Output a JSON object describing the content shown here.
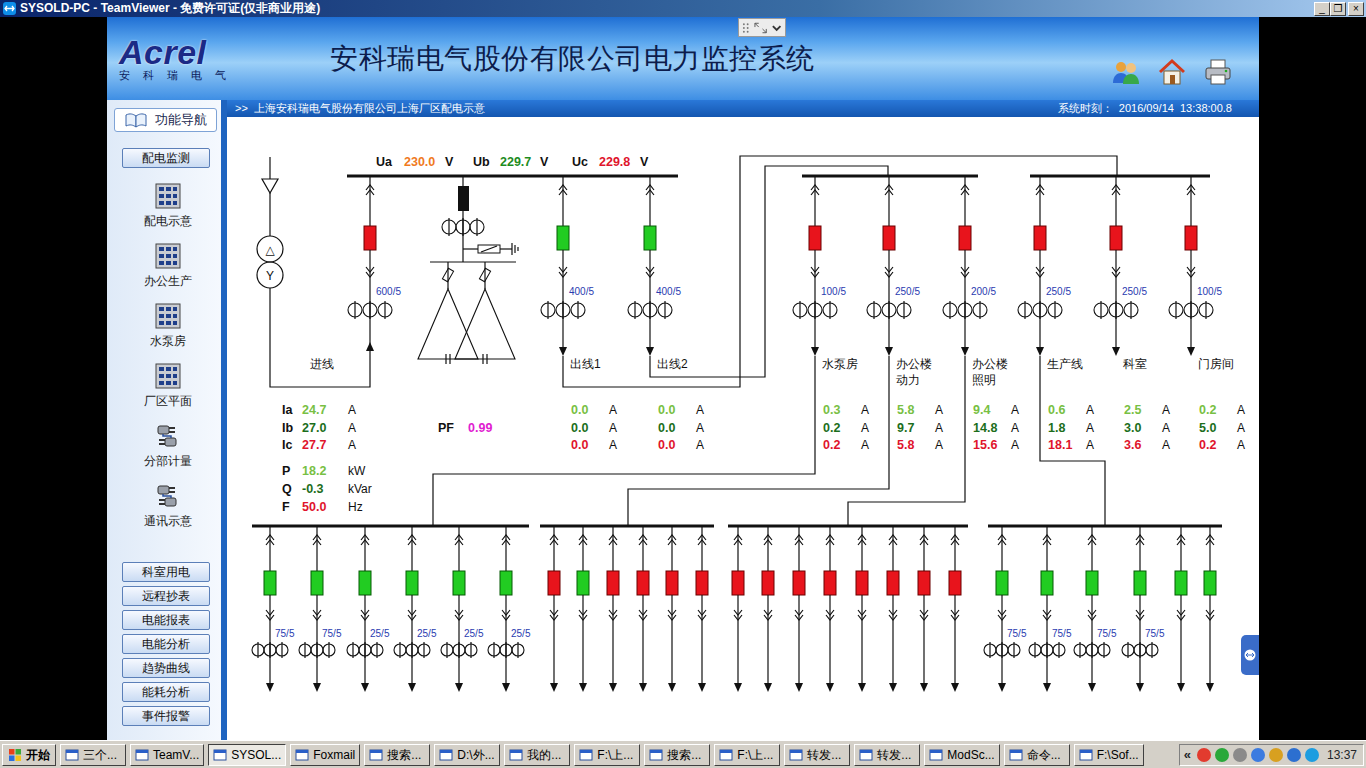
{
  "window": {
    "title": "SYSOLD-PC - TeamViewer - 免费许可证(仅非商业用途)",
    "controls": [
      "_",
      "❐",
      "×"
    ]
  },
  "header": {
    "logo": "Acrel",
    "logo_sub": "安 科 瑞 电 气",
    "title": "安科瑞电气股份有限公司电力监控系统"
  },
  "sidebar": {
    "nav": "功能导航",
    "section": "配电监测",
    "icon_items": [
      {
        "label": "配电示意",
        "kind": "panel"
      },
      {
        "label": "办公生产",
        "kind": "panel"
      },
      {
        "label": "水泵房",
        "kind": "panel"
      },
      {
        "label": "厂区平面",
        "kind": "panel"
      },
      {
        "label": "分部计量",
        "kind": "meter"
      },
      {
        "label": "通讯示意",
        "kind": "meter"
      }
    ],
    "buttons": [
      "科室用电",
      "远程抄表",
      "电能报表",
      "电能分析",
      "趋势曲线",
      "能耗分析",
      "事件报警"
    ]
  },
  "breadcrumb": {
    "marker": ">>",
    "path": "上海安科瑞电气股份有限公司上海厂区配电示意",
    "clock_label": "系统时刻：",
    "clock": "2016/09/14  13:38:00.8"
  },
  "diagram": {
    "voltages": [
      {
        "label": "Ua",
        "value": "230.0",
        "unit": "V",
        "color": "#f07a1e"
      },
      {
        "label": "Ub",
        "value": "229.7",
        "unit": "V",
        "color": "#1e8c1e"
      },
      {
        "label": "Uc",
        "value": "229.8",
        "unit": "V",
        "color": "#e0142c"
      }
    ],
    "winding": [
      "△",
      "Y"
    ],
    "incoming": {
      "label": "进线",
      "ct": "600/5",
      "closed": true,
      "currents": [
        {
          "label": "Ia",
          "value": "24.7",
          "unit": "A",
          "color": "#78c043"
        },
        {
          "label": "Ib",
          "value": "27.0",
          "unit": "A",
          "color": "#1c6e1c"
        },
        {
          "label": "Ic",
          "value": "27.7",
          "unit": "A",
          "color": "#e0142c"
        }
      ],
      "power": [
        {
          "label": "P",
          "value": "18.2",
          "unit": "kW",
          "color": "#78c043"
        },
        {
          "label": "Q",
          "value": "-0.3",
          "unit": "kVar",
          "color": "#1c6e1c"
        },
        {
          "label": "F",
          "value": "50.0",
          "unit": "Hz",
          "color": "#e0142c"
        }
      ],
      "pf": {
        "label": "PF",
        "value": "0.99"
      }
    },
    "current_unit": "A",
    "phase_colors": [
      "#78c043",
      "#1c6e1c",
      "#e0142c"
    ],
    "feeders": [
      {
        "label_lines": [
          "出线1"
        ],
        "ct": "400/5",
        "closed": false,
        "currents": [
          "0.0",
          "0.0",
          "0.0"
        ]
      },
      {
        "label_lines": [
          "出线2"
        ],
        "ct": "400/5",
        "closed": false,
        "currents": [
          "0.0",
          "0.0",
          "0.0"
        ]
      },
      {
        "label_lines": [
          "水泵房"
        ],
        "ct": "100/5",
        "closed": true,
        "currents": [
          "0.3",
          "0.2",
          "0.2"
        ]
      },
      {
        "label_lines": [
          "办公楼",
          "动力"
        ],
        "ct": "250/5",
        "closed": true,
        "currents": [
          "5.8",
          "9.7",
          "5.8"
        ]
      },
      {
        "label_lines": [
          "办公楼",
          "照明"
        ],
        "ct": "200/5",
        "closed": true,
        "currents": [
          "9.4",
          "14.8",
          "15.6"
        ]
      },
      {
        "label_lines": [
          "生产线"
        ],
        "ct": "250/5",
        "closed": true,
        "currents": [
          "0.6",
          "1.8",
          "18.1"
        ]
      },
      {
        "label_lines": [
          "科室"
        ],
        "ct": "250/5",
        "closed": true,
        "currents": [
          "2.5",
          "3.0",
          "3.6"
        ]
      },
      {
        "label_lines": [
          "门房间"
        ],
        "ct": "100/5",
        "closed": true,
        "currents": [
          "0.2",
          "5.0",
          "0.2"
        ]
      }
    ],
    "lower_buses": [
      {
        "feeders": [
          {
            "closed": false,
            "ct": "75/5"
          },
          {
            "closed": false,
            "ct": "75/5"
          },
          {
            "closed": false,
            "ct": "25/5"
          },
          {
            "closed": false,
            "ct": "25/5"
          },
          {
            "closed": false,
            "ct": "25/5"
          },
          {
            "closed": false,
            "ct": "25/5"
          }
        ]
      },
      {
        "feeders": [
          {
            "closed": true,
            "ct": null
          },
          {
            "closed": false,
            "ct": null
          },
          {
            "closed": true,
            "ct": null
          },
          {
            "closed": true,
            "ct": null
          },
          {
            "closed": true,
            "ct": null
          },
          {
            "closed": true,
            "ct": null
          }
        ]
      },
      {
        "feeders": [
          {
            "closed": true,
            "ct": null
          },
          {
            "closed": true,
            "ct": null
          },
          {
            "closed": true,
            "ct": null
          },
          {
            "closed": true,
            "ct": null
          },
          {
            "closed": true,
            "ct": null
          },
          {
            "closed": true,
            "ct": null
          },
          {
            "closed": true,
            "ct": null
          },
          {
            "closed": true,
            "ct": null
          }
        ]
      },
      {
        "feeders": [
          {
            "closed": false,
            "ct": "75/5"
          },
          {
            "closed": false,
            "ct": "75/5"
          },
          {
            "closed": false,
            "ct": "75/5"
          },
          {
            "closed": false,
            "ct": "75/5"
          },
          {
            "closed": false,
            "ct": null
          },
          {
            "closed": false,
            "ct": null
          }
        ]
      }
    ]
  },
  "taskbar": {
    "start": "开始",
    "tasks": [
      {
        "label": "三个...",
        "selected": false
      },
      {
        "label": "TeamV...",
        "selected": false
      },
      {
        "label": "SYSOL...",
        "selected": true
      },
      {
        "label": "Foxmail",
        "selected": false
      },
      {
        "label": "搜索...",
        "selected": false
      },
      {
        "label": "D:\\外...",
        "selected": false
      },
      {
        "label": "我的...",
        "selected": false
      },
      {
        "label": "F:\\上...",
        "selected": false
      },
      {
        "label": "搜索...",
        "selected": false
      },
      {
        "label": "F:\\上...",
        "selected": false
      },
      {
        "label": "转发...",
        "selected": false
      },
      {
        "label": "转发...",
        "selected": false
      },
      {
        "label": "ModSc...",
        "selected": false
      },
      {
        "label": "命令...",
        "selected": false
      },
      {
        "label": "F:\\Sof...",
        "selected": false
      }
    ],
    "tray_toggle": "«",
    "clock": "13:37"
  }
}
